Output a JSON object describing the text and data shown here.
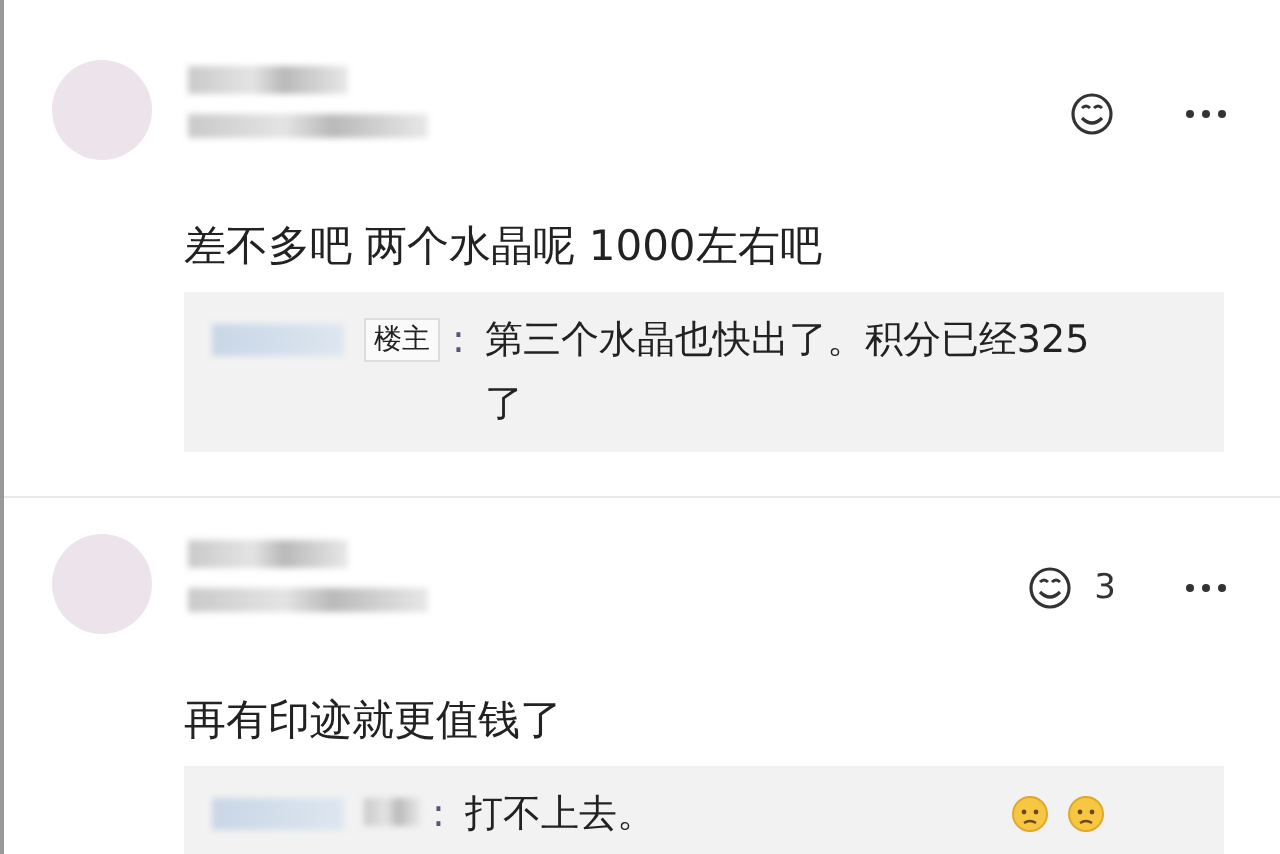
{
  "comments": [
    {
      "text": "差不多吧 两个水晶呢 1000左右吧",
      "reply": {
        "badge": "楼主",
        "separator": ":",
        "text": "第三个水晶也快出了。积分已经325了"
      }
    },
    {
      "text": "再有印迹就更值钱了",
      "like_count": "3",
      "reply": {
        "separator": ":",
        "text": "打不上去。",
        "emojis": [
          {
            "kind": "emoji"
          },
          {
            "kind": "emoji"
          }
        ]
      }
    }
  ]
}
